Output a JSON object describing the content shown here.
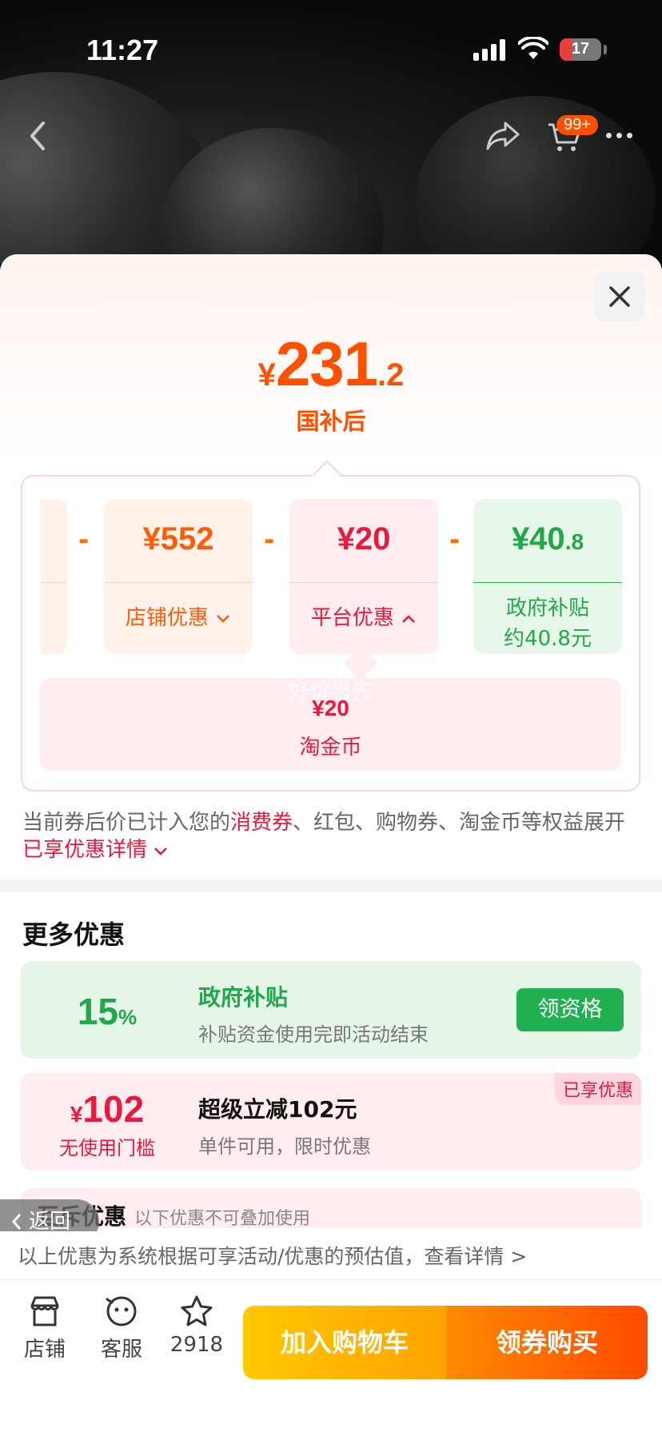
{
  "status_bar": {
    "time": "11:27",
    "battery": "17"
  },
  "nav": {
    "cart_badge": "99+"
  },
  "price": {
    "currency": "¥",
    "integer": "231",
    "decimal": ".2",
    "caption": "国补后"
  },
  "breakdown": {
    "store": {
      "amount": "¥552",
      "label": "店铺优惠"
    },
    "platform": {
      "amount": "¥20",
      "label": "平台优惠"
    },
    "gov": {
      "amount_int": "¥40",
      "amount_dec": ".8",
      "label_line1": "政府补贴",
      "label_line2": "约40.8元"
    },
    "coin": {
      "watermark": "好价当先",
      "amount": "¥20",
      "label": "淘金币"
    },
    "minus": "-"
  },
  "note": {
    "part1": "当前券后价已计入您的",
    "highlight1": "消费券",
    "part2": "、红包、购物券、淘金币等权益展开",
    "highlight2": "已享优惠详情"
  },
  "more_offers": {
    "title": "更多优惠",
    "items": [
      {
        "value": "15",
        "unit": "%",
        "title": "政府补贴",
        "desc": "补贴资金使用完即活动结束",
        "button": "领资格"
      },
      {
        "value": "102",
        "currency": "¥",
        "sub": "无使用门槛",
        "title": "超级立减102元",
        "desc": "单件可用，限时优惠",
        "tag": "已享优惠"
      }
    ],
    "mutex_title": "互斥优惠",
    "mutex_desc": "以下优惠不可叠加使用"
  },
  "back_pill": "返回",
  "footnote": "以上优惠为系统根据可享活动/优惠的预估值，查看详情 >",
  "bottom_bar": {
    "tabs": [
      {
        "label": "店铺"
      },
      {
        "label": "客服"
      },
      {
        "label": "2918"
      }
    ],
    "add_to_cart": "加入购物车",
    "buy": "领券购买"
  },
  "colors": {
    "accent": "#ff5000",
    "red": "#e8193c",
    "green": "#21a84a"
  }
}
